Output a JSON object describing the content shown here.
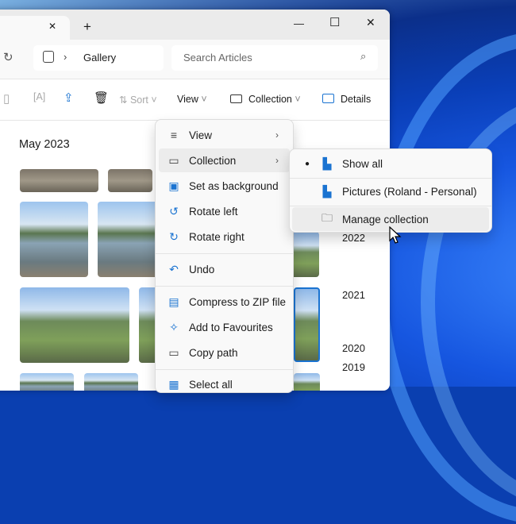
{
  "window": {
    "tab_close": "✕",
    "new_tab": "+",
    "minimize": "—",
    "maximize": "☐",
    "close": "✕"
  },
  "address": {
    "refresh": "↻",
    "chevron": "›",
    "location": "Gallery",
    "search_placeholder": "Search Articles",
    "search_icon": "⌕"
  },
  "toolbar": {
    "sort": "Sort",
    "view": "View",
    "collection": "Collection",
    "details": "Details"
  },
  "content": {
    "section_title": "May 2023",
    "years": [
      "2022",
      "2021",
      "2020",
      "2019"
    ]
  },
  "context_menu": {
    "items": [
      {
        "label": "View",
        "icon": "list-icon",
        "submenu": true
      },
      {
        "label": "Collection",
        "icon": "collection-icon",
        "submenu": true
      },
      {
        "label": "Set as background",
        "icon": "background-icon"
      },
      {
        "label": "Rotate left",
        "icon": "rotate-left-icon"
      },
      {
        "label": "Rotate right",
        "icon": "rotate-right-icon"
      },
      {
        "label": "Undo",
        "icon": "undo-icon"
      },
      {
        "label": "Compress to ZIP file",
        "icon": "zip-icon"
      },
      {
        "label": "Add to Favourites",
        "icon": "pin-icon"
      },
      {
        "label": "Copy path",
        "icon": "copy-path-icon"
      },
      {
        "label": "Select all",
        "icon": "select-all-icon"
      }
    ]
  },
  "submenu": {
    "items": [
      {
        "label": "Show all",
        "selected": true
      },
      {
        "label": "Pictures (Roland - Personal)"
      },
      {
        "label": "Manage collection"
      }
    ]
  },
  "colors": {
    "accent": "#1a73d1"
  }
}
